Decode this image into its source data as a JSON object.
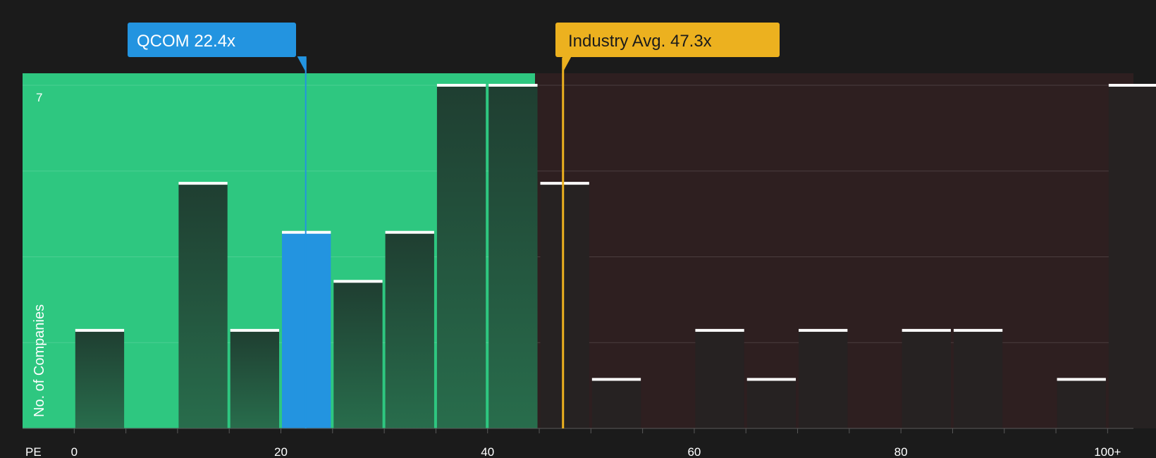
{
  "chart_data": {
    "type": "bar",
    "metric_label": "PE",
    "ylabel": "No. of Companies",
    "y_max_label": "7",
    "ylim": [
      0,
      7
    ],
    "xlim": [
      -5,
      102.5
    ],
    "x_ticks": [
      {
        "value": 0,
        "label": "0"
      },
      {
        "value": 20,
        "label": "20"
      },
      {
        "value": 40,
        "label": "40"
      },
      {
        "value": 60,
        "label": "60"
      },
      {
        "value": 80,
        "label": "80"
      },
      {
        "value": 100,
        "label": "100+"
      }
    ],
    "bin_width": 5,
    "bins": [
      {
        "start": 0,
        "count": 2
      },
      {
        "start": 5,
        "count": 0
      },
      {
        "start": 10,
        "count": 5
      },
      {
        "start": 15,
        "count": 2
      },
      {
        "start": 20,
        "count": 4,
        "highlight": true
      },
      {
        "start": 25,
        "count": 3
      },
      {
        "start": 30,
        "count": 4
      },
      {
        "start": 35,
        "count": 7
      },
      {
        "start": 40,
        "count": 7
      },
      {
        "start": 45,
        "count": 5
      },
      {
        "start": 50,
        "count": 1
      },
      {
        "start": 55,
        "count": 0
      },
      {
        "start": 60,
        "count": 2
      },
      {
        "start": 65,
        "count": 1
      },
      {
        "start": 70,
        "count": 2
      },
      {
        "start": 75,
        "count": 0
      },
      {
        "start": 80,
        "count": 2
      },
      {
        "start": 85,
        "count": 2
      },
      {
        "start": 90,
        "count": 0
      },
      {
        "start": 95,
        "count": 1
      },
      {
        "start": 100,
        "count": 7
      }
    ],
    "company": {
      "label": "QCOM 22.4x",
      "value": 22.4,
      "color": "#2394e0"
    },
    "industry": {
      "label": "Industry Avg. 47.3x",
      "value": 47.3,
      "color": "#ecb11f"
    },
    "colors": {
      "below_region": "#2ec780",
      "above_region": "#2e1f20",
      "bar_dark": "#1f3e31",
      "bar_light": "#286d4c",
      "bar_above": "#262222",
      "cap": "#ffffff",
      "axis": "#5a5a5a"
    }
  }
}
